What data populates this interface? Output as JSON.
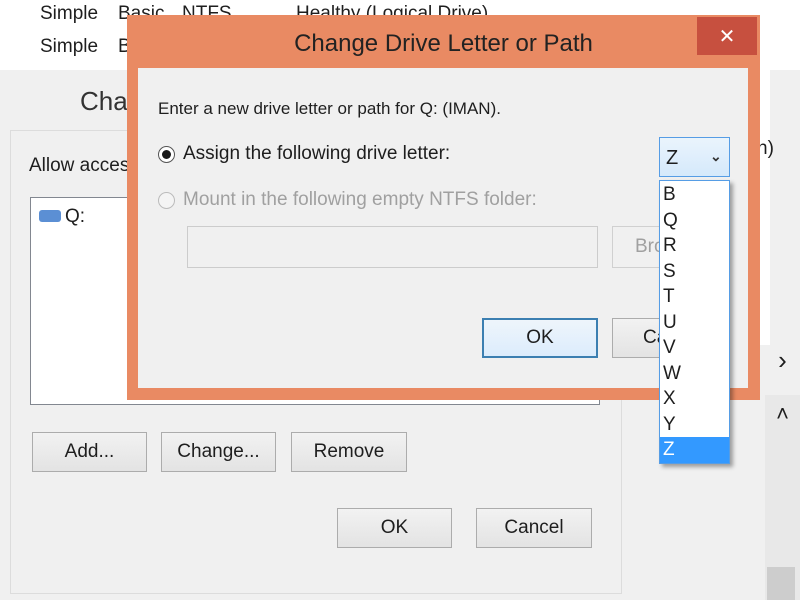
{
  "background_list": {
    "rows": [
      [
        "Simple",
        "Basic",
        "NTFS",
        "Healthy (Logical Drive)"
      ],
      [
        "Simple",
        "B"
      ]
    ],
    "partial_right": "n)"
  },
  "back_dialog": {
    "title": "Char",
    "allow_label": "Allow access",
    "drive_item": "Q:",
    "buttons": {
      "add": "Add...",
      "change": "Change...",
      "remove": "Remove",
      "ok": "OK",
      "cancel": "Cancel"
    }
  },
  "dialog": {
    "title": "Change Drive Letter or Path",
    "close": "✕",
    "prompt": "Enter a new drive letter or path for Q: (IMAN).",
    "assign_label": "Assign the following drive letter:",
    "mount_label": "Mount in the following empty NTFS folder:",
    "folder_value": "",
    "browse": "Bro",
    "ok": "OK",
    "cancel": "Ca",
    "frame_color": "#e98a63",
    "close_color": "#c7503f"
  },
  "combo": {
    "selected": "Z",
    "options": [
      "B",
      "Q",
      "R",
      "S",
      "T",
      "U",
      "V",
      "W",
      "X",
      "Y",
      "Z"
    ]
  },
  "scroll": {
    "right": "›",
    "up": "˄"
  }
}
